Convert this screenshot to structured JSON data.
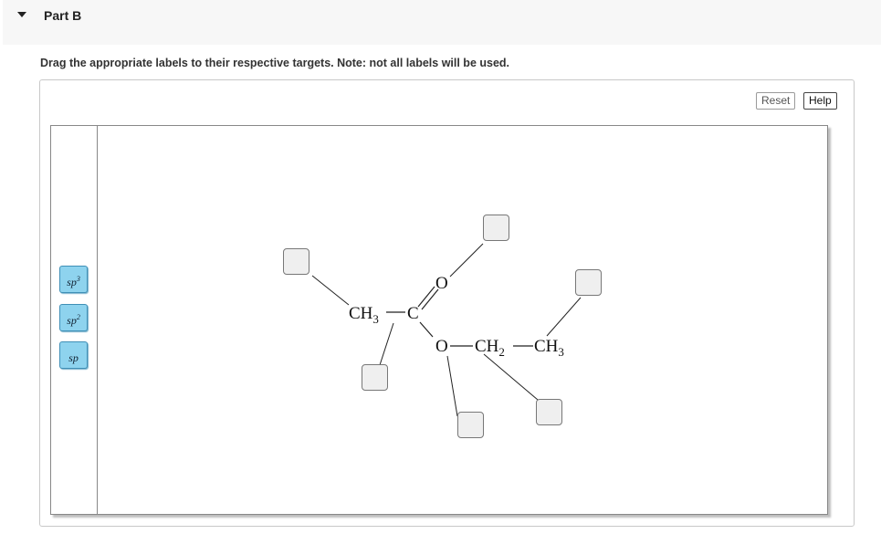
{
  "header": {
    "title": "Part B"
  },
  "instructions": "Drag the appropriate labels to their respective targets. Note: not all labels will be used.",
  "buttons": {
    "reset": "Reset",
    "help": "Help"
  },
  "labels": [
    {
      "base": "sp",
      "sup": "3"
    },
    {
      "base": "sp",
      "sup": "2"
    },
    {
      "base": "sp",
      "sup": ""
    }
  ],
  "molecule": {
    "ch3_left": {
      "base": "CH",
      "sub": "3"
    },
    "carbonyl_c": "C",
    "carbonyl_o": "O",
    "ester_o": "O",
    "ch2": {
      "base": "CH",
      "sub": "2"
    },
    "ch3_right": {
      "base": "CH",
      "sub": "3"
    }
  },
  "drop_targets": [
    "target-1",
    "target-2",
    "target-3",
    "target-4",
    "target-5",
    "target-6"
  ]
}
